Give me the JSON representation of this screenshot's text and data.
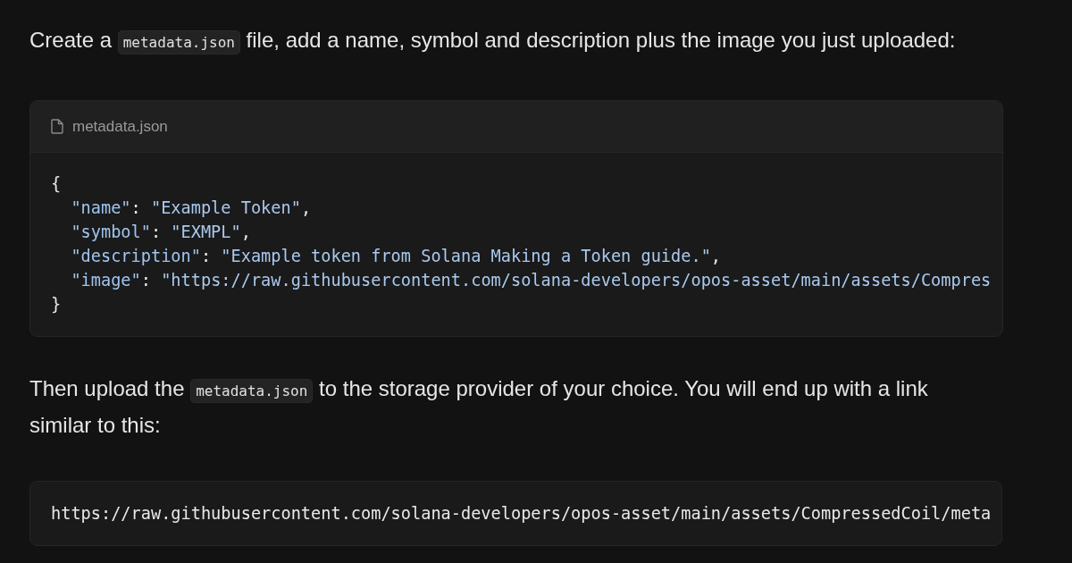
{
  "intro": [
    {
      "kind": "text",
      "text": "Create a "
    },
    {
      "kind": "code",
      "text": "metadata.json"
    },
    {
      "kind": "text",
      "text": " file, add a name, symbol and description plus the image you just uploaded:"
    }
  ],
  "code_block": {
    "filename": "metadata.json",
    "lines": [
      {
        "tokens": [
          {
            "kind": "punct",
            "text": "{"
          }
        ],
        "children": [
          {
            "tokens": [
              {
                "kind": "key",
                "text": "\"name\""
              },
              {
                "kind": "punct",
                "text": ": "
              },
              {
                "kind": "string",
                "text": "\"Example Token\""
              },
              {
                "kind": "punct",
                "text": ","
              }
            ]
          },
          {
            "tokens": [
              {
                "kind": "key",
                "text": "\"symbol\""
              },
              {
                "kind": "punct",
                "text": ": "
              },
              {
                "kind": "string",
                "text": "\"EXMPL\""
              },
              {
                "kind": "punct",
                "text": ","
              }
            ]
          },
          {
            "tokens": [
              {
                "kind": "key",
                "text": "\"description\""
              },
              {
                "kind": "punct",
                "text": ": "
              },
              {
                "kind": "string",
                "text": "\"Example token from Solana Making a Token guide.\""
              },
              {
                "kind": "punct",
                "text": ","
              }
            ]
          },
          {
            "tokens": [
              {
                "kind": "key",
                "text": "\"image\""
              },
              {
                "kind": "punct",
                "text": ": "
              },
              {
                "kind": "string",
                "text": "\"https://raw.githubusercontent.com/solana-developers/opos-asset/main/assets/Compres"
              }
            ]
          }
        ]
      },
      {
        "tokens": [
          {
            "kind": "punct",
            "text": "}"
          }
        ]
      }
    ]
  },
  "outro": [
    {
      "kind": "text",
      "text": "Then upload the "
    },
    {
      "kind": "code",
      "text": "metadata.json"
    },
    {
      "kind": "text",
      "text": " to the storage provider of your choice. You will end up with a link similar to this:"
    }
  ],
  "link_block": {
    "text": "https://raw.githubusercontent.com/solana-developers/opos-asset/main/assets/CompressedCoil/meta"
  }
}
